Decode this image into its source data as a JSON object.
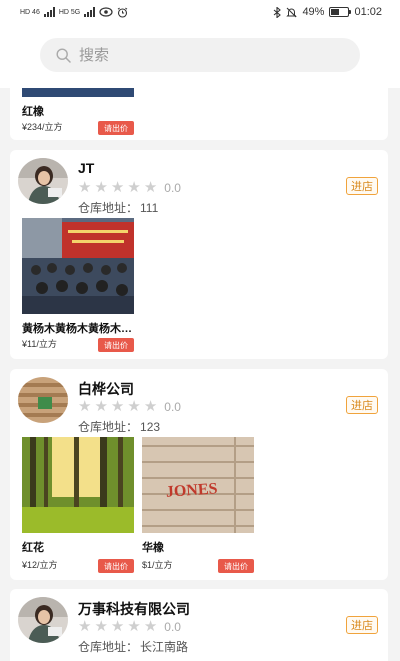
{
  "status_bar": {
    "net1": "HD 46",
    "net2": "HD 5G",
    "battery": "49%",
    "time": "01:02"
  },
  "search": {
    "placeholder": "搜索"
  },
  "partial_product": {
    "name": "红橡",
    "price": "¥234/立方",
    "inquiry": "请出价"
  },
  "shops": [
    {
      "name": "JT",
      "rating": "0.0",
      "address_label": "仓库地址：",
      "address": "111",
      "enter": "进店",
      "products": [
        {
          "name": "黄杨木黄杨木黄杨木黄杨木",
          "price": "¥11/立方",
          "inquiry": "请出价"
        }
      ]
    },
    {
      "name": "白桦公司",
      "rating": "0.0",
      "address_label": "仓库地址：",
      "address": "123",
      "enter": "进店",
      "products": [
        {
          "name": "红花",
          "price": "¥12/立方",
          "inquiry": "请出价"
        },
        {
          "name": "华橡",
          "price": "$1/立方",
          "inquiry": "请出价",
          "image_text": "JONES"
        }
      ]
    },
    {
      "name": "万事科技有限公司",
      "rating": "0.0",
      "address_label": "仓库地址：",
      "address": "长江南路",
      "enter": "进店",
      "products": []
    }
  ]
}
